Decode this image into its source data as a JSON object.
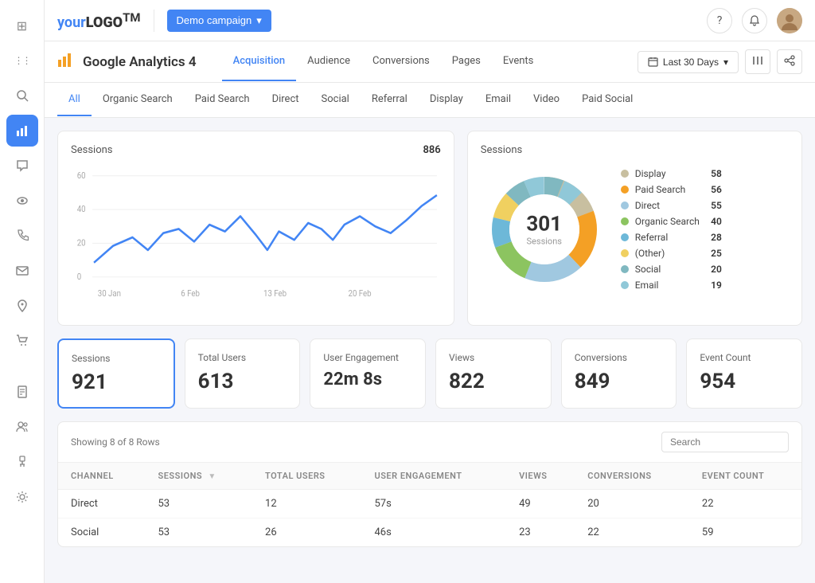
{
  "sidebar": {
    "icons": [
      {
        "name": "grid-icon",
        "symbol": "⊞",
        "active": false
      },
      {
        "name": "apps-icon",
        "symbol": "⋮⋮",
        "active": false
      },
      {
        "name": "search-icon",
        "symbol": "🔍",
        "active": false
      },
      {
        "name": "analytics-icon",
        "symbol": "📊",
        "active": true
      },
      {
        "name": "chat-icon",
        "symbol": "💬",
        "active": false
      },
      {
        "name": "settings2-icon",
        "symbol": "⚙",
        "active": false
      },
      {
        "name": "phone-icon",
        "symbol": "📞",
        "active": false
      },
      {
        "name": "mail-icon",
        "symbol": "✉",
        "active": false
      },
      {
        "name": "location-icon",
        "symbol": "📍",
        "active": false
      },
      {
        "name": "cart-icon",
        "symbol": "🛒",
        "active": false
      },
      {
        "name": "doc-icon",
        "symbol": "📄",
        "active": false
      },
      {
        "name": "users-icon",
        "symbol": "👥",
        "active": false
      },
      {
        "name": "plug-icon",
        "symbol": "🔌",
        "active": false
      },
      {
        "name": "gear-icon",
        "symbol": "⚙",
        "active": false
      }
    ]
  },
  "topbar": {
    "logo": "your",
    "logo_bold": "LOGO",
    "logo_tm": "TM",
    "demo_btn": "Demo campaign",
    "help_icon": "?",
    "bell_icon": "🔔"
  },
  "sub_header": {
    "page_icon": "📊",
    "page_title": "Google Analytics 4",
    "tabs": [
      {
        "label": "Acquisition",
        "active": true
      },
      {
        "label": "Audience",
        "active": false
      },
      {
        "label": "Conversions",
        "active": false
      },
      {
        "label": "Pages",
        "active": false
      },
      {
        "label": "Events",
        "active": false
      }
    ],
    "date_btn": "Last 30 Days",
    "columns_icon": "|||",
    "share_icon": "⬆"
  },
  "channel_tabs": [
    {
      "label": "All",
      "active": true
    },
    {
      "label": "Organic Search",
      "active": false
    },
    {
      "label": "Paid Search",
      "active": false
    },
    {
      "label": "Direct",
      "active": false
    },
    {
      "label": "Social",
      "active": false
    },
    {
      "label": "Referral",
      "active": false
    },
    {
      "label": "Display",
      "active": false
    },
    {
      "label": "Email",
      "active": false
    },
    {
      "label": "Video",
      "active": false
    },
    {
      "label": "Paid Social",
      "active": false
    }
  ],
  "line_chart": {
    "title": "Sessions",
    "value": "886",
    "x_labels": [
      "30 Jan",
      "6 Feb",
      "13 Feb",
      "20 Feb"
    ],
    "y_labels": [
      "60",
      "40",
      "20",
      "0"
    ]
  },
  "donut_chart": {
    "title": "Sessions",
    "center_value": "301",
    "center_label": "Sessions",
    "legend": [
      {
        "label": "Display",
        "value": "58",
        "color": "#c8bfa0"
      },
      {
        "label": "Paid Search",
        "value": "56",
        "color": "#f4a025"
      },
      {
        "label": "Direct",
        "value": "55",
        "color": "#a0c8e0"
      },
      {
        "label": "Organic Search",
        "value": "40",
        "color": "#8cc460"
      },
      {
        "label": "Referral",
        "value": "28",
        "color": "#6db8d8"
      },
      {
        "label": "(Other)",
        "value": "25",
        "color": "#f0d060"
      },
      {
        "label": "Social",
        "value": "20",
        "color": "#80b8c0"
      },
      {
        "label": "Email",
        "value": "19",
        "color": "#90c8d8"
      }
    ]
  },
  "metrics": [
    {
      "label": "Sessions",
      "value": "921",
      "selected": true
    },
    {
      "label": "Total Users",
      "value": "613",
      "selected": false
    },
    {
      "label": "User Engagement",
      "value": "22m 8s",
      "selected": false
    },
    {
      "label": "Views",
      "value": "822",
      "selected": false
    },
    {
      "label": "Conversions",
      "value": "849",
      "selected": false
    },
    {
      "label": "Event Count",
      "value": "954",
      "selected": false
    }
  ],
  "table": {
    "showing_text": "Showing 8 of 8 Rows",
    "search_placeholder": "Search",
    "columns": [
      {
        "label": "CHANNEL",
        "sortable": false
      },
      {
        "label": "SESSIONS",
        "sortable": true
      },
      {
        "label": "TOTAL USERS",
        "sortable": false
      },
      {
        "label": "USER ENGAGEMENT",
        "sortable": false
      },
      {
        "label": "VIEWS",
        "sortable": false
      },
      {
        "label": "CONVERSIONS",
        "sortable": false
      },
      {
        "label": "EVENT COUNT",
        "sortable": false
      }
    ],
    "rows": [
      {
        "channel": "Direct",
        "sessions": "53",
        "total_users": "12",
        "user_engagement": "57s",
        "views": "49",
        "conversions": "20",
        "event_count": "22"
      },
      {
        "channel": "Social",
        "sessions": "53",
        "total_users": "26",
        "user_engagement": "46s",
        "views": "23",
        "conversions": "22",
        "event_count": "59"
      }
    ]
  }
}
